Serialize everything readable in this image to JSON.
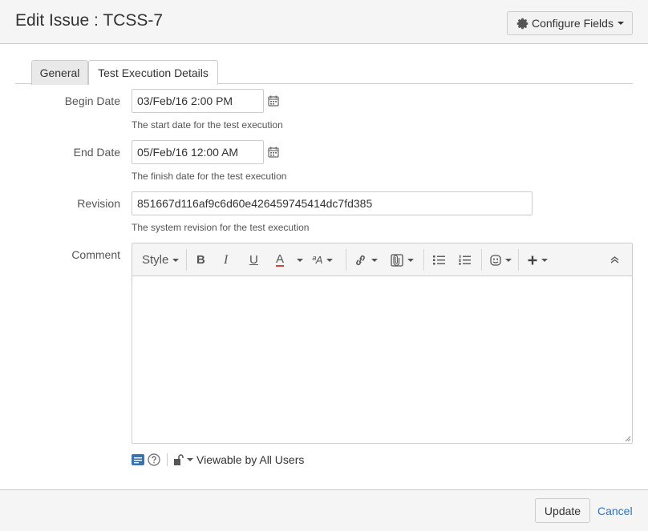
{
  "dialog": {
    "title": "Edit Issue : TCSS-7",
    "configure_fields_label": "Configure Fields"
  },
  "tabs": [
    {
      "label": "General",
      "active": false
    },
    {
      "label": "Test Execution Details",
      "active": true
    }
  ],
  "fields": {
    "begin_date": {
      "label": "Begin Date",
      "value": "03/Feb/16 2:00 PM",
      "hint": "The start date for the test execution"
    },
    "end_date": {
      "label": "End Date",
      "value": "05/Feb/16 12:00 AM",
      "hint": "The finish date for the test execution"
    },
    "revision": {
      "label": "Revision",
      "value": "851667d116af9c6d60e426459745414dc7fd385",
      "hint": "The system revision for the test execution"
    },
    "comment": {
      "label": "Comment",
      "value": ""
    }
  },
  "editor_toolbar": {
    "style_label": "Style",
    "bold": "B",
    "italic": "I",
    "underline": "U",
    "text_color": "A",
    "text_color_underline": "#d04437",
    "more_formatting": "ªA",
    "icons": [
      "link-icon",
      "attachment-icon",
      "bullet-list-icon",
      "numbered-list-icon",
      "emoticon-icon",
      "plus-icon",
      "collapse-icon"
    ]
  },
  "comment_footer": {
    "viewable_label": "Viewable by All Users"
  },
  "footer": {
    "update_label": "Update",
    "cancel_label": "Cancel"
  },
  "colors": {
    "link": "#3572b0",
    "header_bg": "#f5f5f5",
    "border": "#cccccc"
  }
}
